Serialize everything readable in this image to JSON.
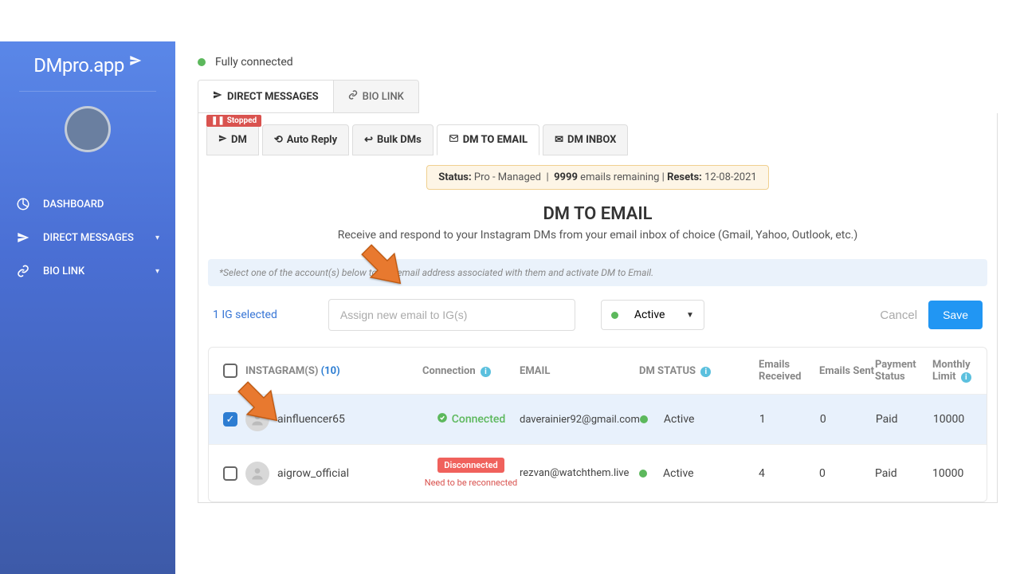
{
  "brand": "DMpro.app",
  "sidebar": {
    "items": [
      {
        "label": "DASHBOARD"
      },
      {
        "label": "DIRECT MESSAGES"
      },
      {
        "label": "BIO LINK"
      }
    ]
  },
  "status_line": "Fully connected",
  "outer_tabs": {
    "direct_messages": "DIRECT MESSAGES",
    "bio_link": "BIO LINK"
  },
  "stopped_badge": "Stopped",
  "subtabs": {
    "dm": "DM",
    "auto_reply": "Auto Reply",
    "bulk_dms": "Bulk DMs",
    "dm_to_email": "DM TO EMAIL",
    "dm_inbox": "DM INBOX"
  },
  "banner": {
    "status_label": "Status:",
    "plan": "Pro - Managed",
    "remaining_count": "9999",
    "remaining_label": "emails remaining",
    "resets_label": "Resets:",
    "resets_date": "12-08-2021"
  },
  "page_title": "DM TO EMAIL",
  "page_sub": "Receive and respond to your Instagram DMs from your email inbox of choice (Gmail, Yahoo, Outlook, etc.)",
  "help_strip": "*Select one of the account(s) below to edit email address associated with them and activate DM to Email.",
  "controls": {
    "selected_label": "1 IG selected",
    "email_placeholder": "Assign new email to IG(s)",
    "status_value": "Active",
    "cancel": "Cancel",
    "save": "Save"
  },
  "columns": {
    "instagram": "INSTAGRAM(S)",
    "count": "(10)",
    "connection": "Connection",
    "email": "EMAIL",
    "dm_status": "DM STATUS",
    "emails_received": "Emails Received",
    "emails_sent": "Emails Sent",
    "payment_status": "Payment Status",
    "monthly_limit": "Monthly Limit"
  },
  "rows": [
    {
      "checked": true,
      "username": "ainfluencer65",
      "connection": "Connected",
      "connection_ok": true,
      "email": "daverainier92@gmail.com",
      "dm_status": "Active",
      "emails_received": "1",
      "emails_sent": "0",
      "payment_status": "Paid",
      "monthly_limit": "10000"
    },
    {
      "checked": false,
      "username": "aigrow_official",
      "connection": "Disconnected",
      "connection_ok": false,
      "reconnect_msg": "Need to be reconnected",
      "email": "rezvan@watchthem.live",
      "dm_status": "Active",
      "emails_received": "4",
      "emails_sent": "0",
      "payment_status": "Paid",
      "monthly_limit": "10000"
    }
  ]
}
